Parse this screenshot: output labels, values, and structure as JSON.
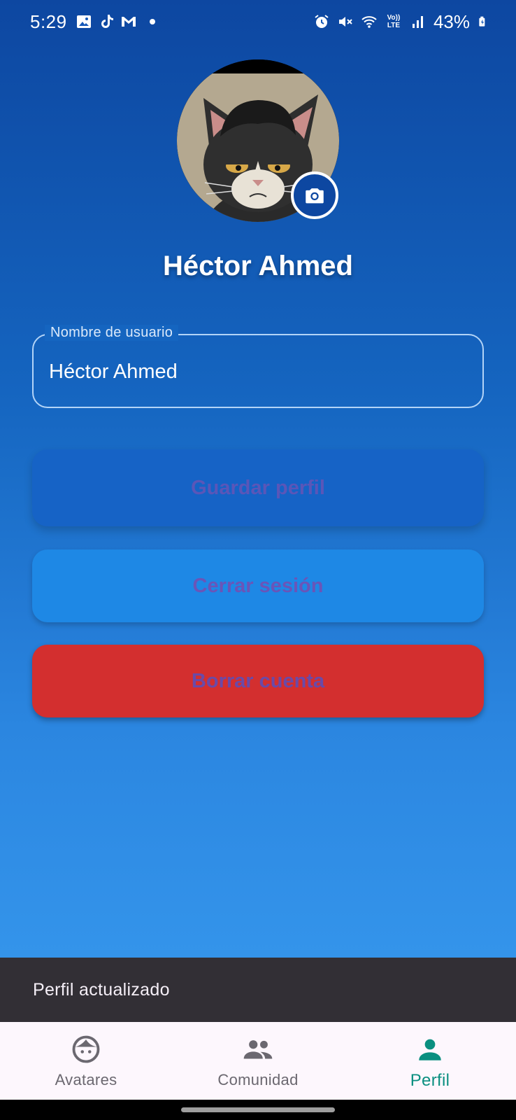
{
  "status_bar": {
    "time": "5:29",
    "battery": "43%",
    "left_icons": [
      "gallery-icon",
      "tiktok-icon",
      "gmail-icon",
      "notification-dot"
    ],
    "right_icons": [
      "alarm-icon",
      "mute-icon",
      "wifi-icon",
      "volte-icon",
      "signal-icon",
      "battery-icon"
    ],
    "volte_label": "Vo)) LTE"
  },
  "profile": {
    "name": "Héctor Ahmed",
    "avatar": "cat-avatar"
  },
  "form": {
    "username_label": "Nombre de usuario",
    "username_value": "Héctor Ahmed"
  },
  "buttons": {
    "save": "Guardar perfil",
    "logout": "Cerrar sesión",
    "delete": "Borrar cuenta"
  },
  "snackbar": {
    "message": "Perfil actualizado"
  },
  "bottom_nav": {
    "items": [
      {
        "label": "Avatares",
        "icon": "face-icon"
      },
      {
        "label": "Comunidad",
        "icon": "people-icon"
      },
      {
        "label": "Perfil",
        "icon": "person-icon",
        "active": true
      }
    ]
  },
  "colors": {
    "accent": "#0a8f80",
    "delete": "#d32f2f",
    "primary": "#1565c0"
  }
}
